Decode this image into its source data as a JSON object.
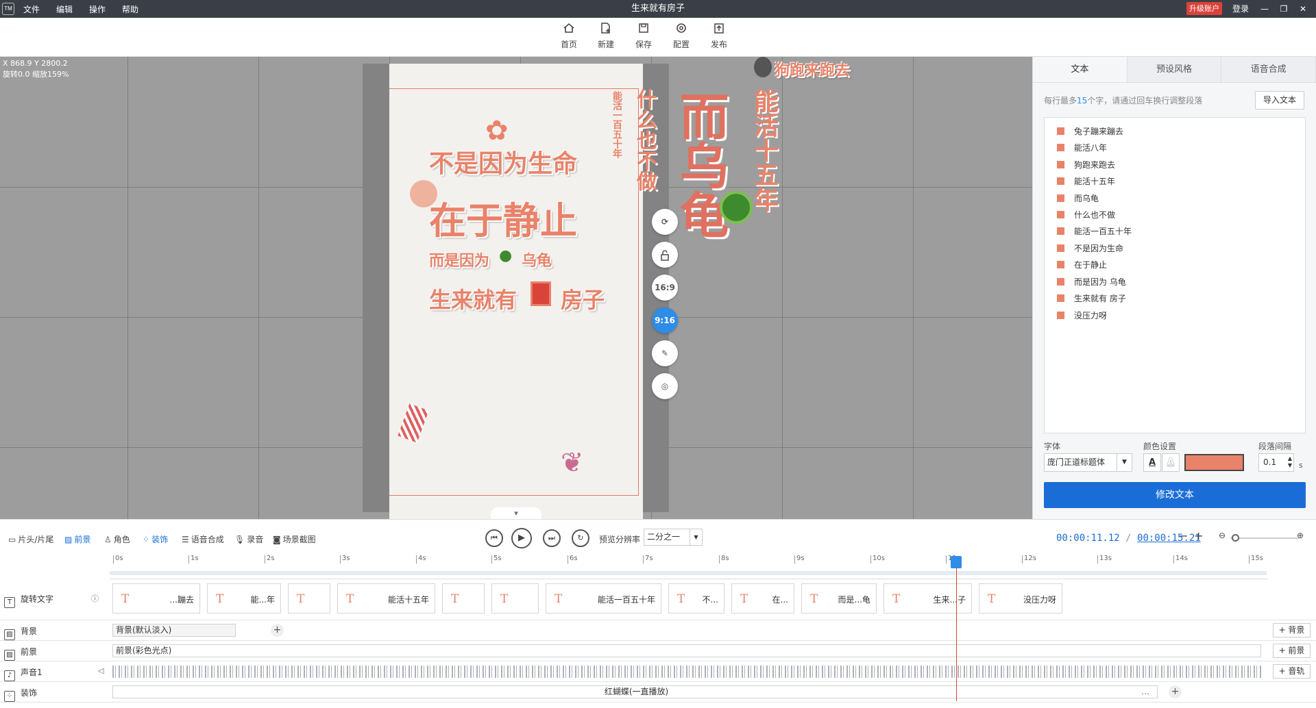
{
  "app": {
    "logo": "TM",
    "window_title": "生来就有房子",
    "upgrade": "升级账户",
    "login": "登录"
  },
  "menu": [
    "文件",
    "编辑",
    "操作",
    "帮助"
  ],
  "toolbar": {
    "home": "首页",
    "new": "新建",
    "save": "保存",
    "config": "配置",
    "publish": "发布"
  },
  "canvas": {
    "coords": "X 868.9 Y 2800.2",
    "transform": "旋转0.0 缩放159%",
    "texts": {
      "line1": "不是因为生命",
      "line2": "在于静止",
      "line3a": "而是因为",
      "line3b": "乌龟",
      "line4a": "生来就有",
      "line4b": "房子",
      "v_nothing": "什么也不做",
      "v_150": "能活一百五十年",
      "v_dog": "狗跑来跑去",
      "v_turtle": "而乌龟",
      "v_15": "能活十五年"
    },
    "side_buttons": {
      "r169": "16:9",
      "r916": "9:16"
    }
  },
  "right_panel": {
    "tabs": [
      "文本",
      "预设风格",
      "语音合成"
    ],
    "hint_pre": "每行最多",
    "hint_num": "15",
    "hint_post": "个字，请通过回车换行调整段落",
    "import_label": "导入文本",
    "lines": [
      "兔子蹦来蹦去",
      "能活八年",
      "狗跑来跑去",
      "能活十五年",
      "而乌龟",
      "什么也不做",
      "能活一百五十年",
      "不是因为生命",
      "在于静止",
      "而是因为  乌龟",
      "生来就有  房子",
      "没压力呀"
    ],
    "font_label": "字体",
    "font_value": "庞门正道标题体",
    "color_label": "颜色设置",
    "spacing_label": "段落间隔",
    "spacing_value": "0.1",
    "spacing_unit": "s",
    "text_color": "#e8836a",
    "modify_label": "修改文本"
  },
  "controls": {
    "intro": "片头/片尾",
    "foreground": "前景",
    "role": "角色",
    "decor": "装饰",
    "tts": "语音合成",
    "record": "录音",
    "screenshot": "场景截图",
    "preview_label": "预览分辨率",
    "preview_value": "二分之一",
    "time_current": "00:00:11.12",
    "time_sep": " / ",
    "time_total": "00:00:15.21"
  },
  "ruler": [
    "0s",
    "1s",
    "2s",
    "3s",
    "4s",
    "5s",
    "6s",
    "7s",
    "8s",
    "9s",
    "10s",
    "11s",
    "12s",
    "13s",
    "14s",
    "15s"
  ],
  "tracks": {
    "text_track": "旋转文字",
    "bg_track": "背景",
    "bg_clip": "背景(默认淡入)",
    "fg_track": "前景",
    "fg_clip": "前景(彩色光点)",
    "audio_track": "声音1",
    "decor_track": "装饰",
    "decor_clip": "红蝴蝶(一直播放)",
    "add_bg": "+ 背景",
    "add_fg": "+ 前景",
    "add_audio": "+ 音轨",
    "clips": [
      "...蹦去",
      "能...年",
      "",
      "能活十五年",
      "",
      "",
      "能活一百五十年",
      "不...",
      "在...",
      "而是...龟",
      "生来...子",
      "没压力呀"
    ]
  }
}
